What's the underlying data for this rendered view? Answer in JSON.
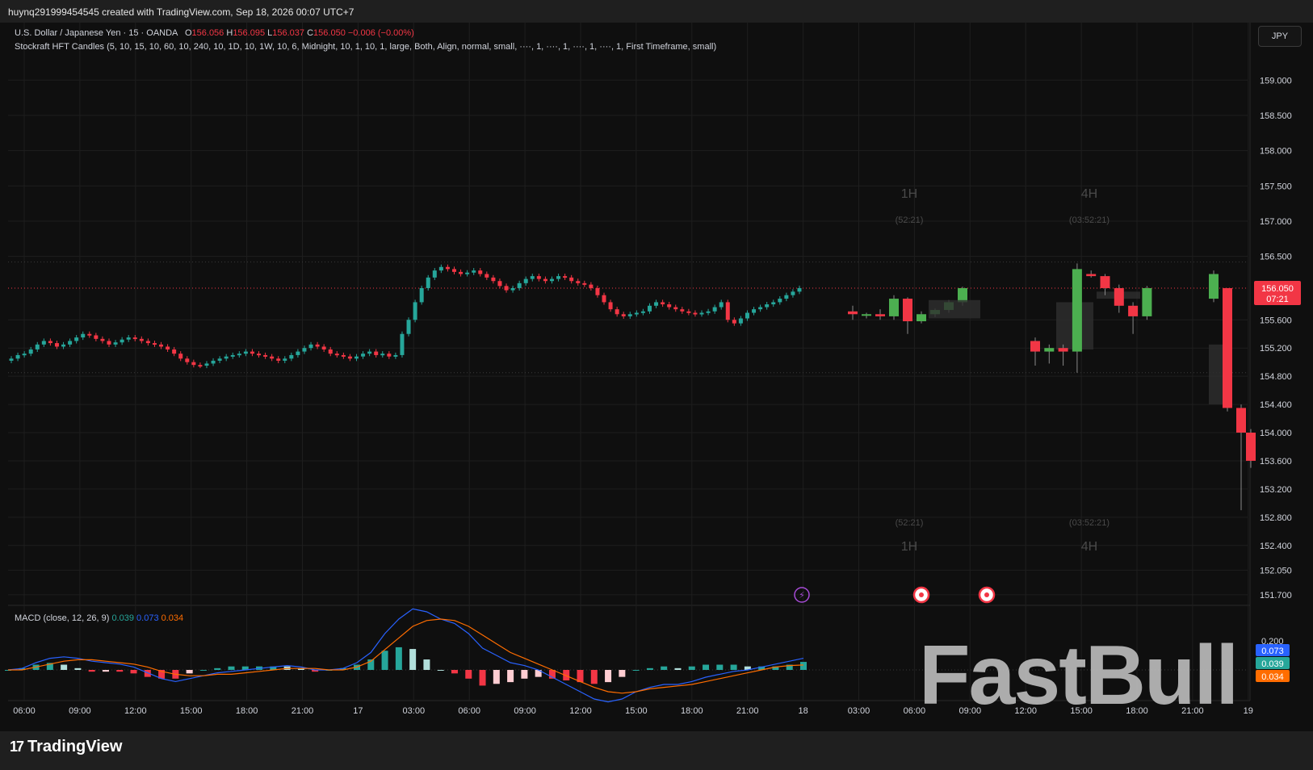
{
  "header": {
    "caption": "huynq291999454545 created with TradingView.com, Sep 18, 2026 00:07 UTC+7"
  },
  "legend": {
    "symbol": "U.S. Dollar / Japanese Yen · 15 · OANDA",
    "o_label": "O",
    "o_value": "156.056",
    "h_label": "H",
    "h_value": "156.095",
    "l_label": "L",
    "l_value": "156.037",
    "c_label": "C",
    "c_value": "156.050",
    "change": "−0.006 (−0.00%)",
    "indicator": "Stockraft HFT Candles (5, 10, 15, 10, 60, 10, 240, 10, 1D, 10, 1W, 10, 6, Midnight, 10, 1, 10, 1, large, Both, Align, normal, small, ····, 1, ····, 1, ····, 1, ····, 1, First Timeframe, small)"
  },
  "currency_button": "JPY",
  "macd_legend": {
    "label": "MACD (close, 12, 26, 9)",
    "histogram": "0.039",
    "macd": "0.073",
    "signal": "0.034"
  },
  "watermark": "FastBull",
  "branding": "TradingView",
  "colors": {
    "up": "#26a69a",
    "down": "#f23645",
    "htf_up": "#4caf50",
    "htf_down": "#f23645",
    "macd": "#2962ff",
    "signal": "#ff6d00",
    "price_label": "#f23645"
  },
  "chart_data": {
    "type": "candlestick",
    "instrument": "U.S. Dollar / Japanese Yen",
    "timeframe": "15",
    "price_axis": {
      "ticks": [
        "159.000",
        "158.500",
        "158.000",
        "157.500",
        "157.000",
        "156.500",
        "155.600",
        "155.200",
        "154.800",
        "154.400",
        "154.000",
        "153.600",
        "153.200",
        "152.800",
        "152.400",
        "152.050",
        "151.700"
      ],
      "current_price": "156.050",
      "countdown": "07:21"
    },
    "time_axis": {
      "labels": [
        "06:00",
        "09:00",
        "12:00",
        "15:00",
        "18:00",
        "21:00",
        "17",
        "03:00",
        "06:00",
        "09:00",
        "12:00",
        "15:00",
        "18:00",
        "21:00",
        "18",
        "03:00",
        "06:00",
        "09:00",
        "12:00",
        "15:00",
        "18:00",
        "21:00",
        "19"
      ]
    },
    "htf_labels": {
      "h1": "1H",
      "h1_timer": "(52:21)",
      "h4": "4H",
      "h4_timer": "(03:52:21)"
    },
    "close_series_15m": [
      155.05,
      155.1,
      155.12,
      155.18,
      155.25,
      155.3,
      155.27,
      155.22,
      155.25,
      155.3,
      155.35,
      155.4,
      155.38,
      155.33,
      155.3,
      155.25,
      155.28,
      155.32,
      155.35,
      155.33,
      155.3,
      155.27,
      155.25,
      155.22,
      155.18,
      155.12,
      155.05,
      155,
      154.96,
      154.95,
      154.98,
      155.02,
      155.05,
      155.08,
      155.1,
      155.12,
      155.15,
      155.12,
      155.1,
      155.08,
      155.05,
      155.02,
      155.05,
      155.1,
      155.15,
      155.2,
      155.25,
      155.22,
      155.18,
      155.12,
      155.1,
      155.08,
      155.05,
      155.08,
      155.12,
      155.15,
      155.1,
      155.12,
      155.08,
      155.1,
      155.4,
      155.6,
      155.85,
      156.05,
      156.2,
      156.3,
      156.35,
      156.32,
      156.28,
      156.25,
      156.27,
      156.3,
      156.25,
      156.2,
      156.15,
      156.08,
      156.02,
      156.05,
      156.12,
      156.18,
      156.22,
      156.18,
      156.15,
      156.18,
      156.22,
      156.2,
      156.15,
      156.12,
      156.1,
      156.05,
      155.95,
      155.85,
      155.75,
      155.68,
      155.65,
      155.68,
      155.7,
      155.72,
      155.8,
      155.85,
      155.82,
      155.78,
      155.75,
      155.72,
      155.7,
      155.68,
      155.7,
      155.72,
      155.78,
      155.85,
      155.6,
      155.55,
      155.62,
      155.7,
      155.75,
      155.78,
      155.82,
      155.85,
      155.9,
      155.95,
      156.0,
      156.05
    ],
    "macd_series": [
      0.0,
      0.01,
      0.05,
      0.08,
      0.09,
      0.08,
      0.06,
      0.05,
      0.04,
      0.02,
      -0.02,
      -0.06,
      -0.08,
      -0.06,
      -0.04,
      -0.02,
      -0.01,
      0.0,
      0.01,
      0.02,
      0.03,
      0.02,
      0.0,
      0.0,
      0.01,
      0.05,
      0.12,
      0.25,
      0.35,
      0.42,
      0.4,
      0.35,
      0.32,
      0.25,
      0.15,
      0.1,
      0.05,
      0.03,
      0.0,
      -0.05,
      -0.1,
      -0.15,
      -0.2,
      -0.22,
      -0.2,
      -0.15,
      -0.12,
      -0.1,
      -0.1,
      -0.08,
      -0.05,
      -0.03,
      -0.01,
      0.0,
      0.02,
      0.04,
      0.06,
      0.08
    ],
    "signal_series": [
      0.0,
      0.0,
      0.02,
      0.04,
      0.06,
      0.07,
      0.07,
      0.06,
      0.05,
      0.04,
      0.02,
      -0.01,
      -0.03,
      -0.04,
      -0.04,
      -0.03,
      -0.03,
      -0.02,
      -0.01,
      0.0,
      0.01,
      0.01,
      0.01,
      0.0,
      0.0,
      0.02,
      0.06,
      0.14,
      0.22,
      0.3,
      0.34,
      0.35,
      0.34,
      0.3,
      0.24,
      0.18,
      0.12,
      0.08,
      0.04,
      0.0,
      -0.04,
      -0.08,
      -0.12,
      -0.15,
      -0.16,
      -0.15,
      -0.13,
      -0.12,
      -0.11,
      -0.1,
      -0.08,
      -0.06,
      -0.04,
      -0.02,
      0.0,
      0.02,
      0.03,
      0.034
    ],
    "macd_axis": {
      "tick": "0.200",
      "macd_value": "0.073",
      "histogram_value": "0.039",
      "signal_value": "0.034"
    }
  }
}
